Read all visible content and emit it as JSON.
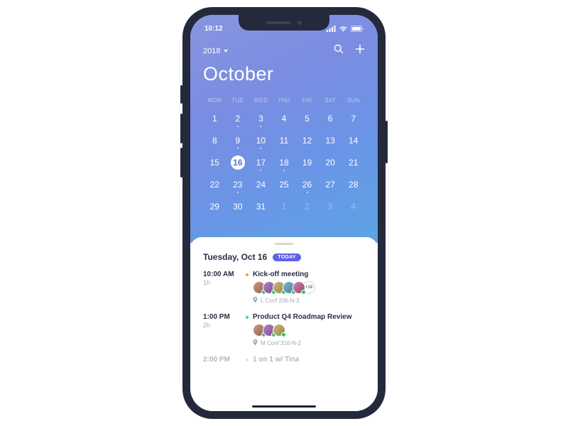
{
  "status": {
    "time": "10:12"
  },
  "header": {
    "year": "2018",
    "month": "October"
  },
  "dow": [
    "MON",
    "TUE",
    "WED",
    "THU",
    "FRI",
    "SAT",
    "SUN"
  ],
  "days": [
    {
      "n": "1"
    },
    {
      "n": "2",
      "dot": true
    },
    {
      "n": "3",
      "dot": true
    },
    {
      "n": "4"
    },
    {
      "n": "5"
    },
    {
      "n": "6"
    },
    {
      "n": "7"
    },
    {
      "n": "8"
    },
    {
      "n": "9",
      "dot": true
    },
    {
      "n": "10",
      "dot": true
    },
    {
      "n": "11"
    },
    {
      "n": "12"
    },
    {
      "n": "13"
    },
    {
      "n": "14"
    },
    {
      "n": "15"
    },
    {
      "n": "16",
      "sel": true
    },
    {
      "n": "17",
      "dot": true
    },
    {
      "n": "18",
      "dot": true
    },
    {
      "n": "19"
    },
    {
      "n": "20"
    },
    {
      "n": "21"
    },
    {
      "n": "22"
    },
    {
      "n": "23",
      "dot": true
    },
    {
      "n": "24"
    },
    {
      "n": "25"
    },
    {
      "n": "26",
      "dot": true
    },
    {
      "n": "27"
    },
    {
      "n": "28"
    },
    {
      "n": "29"
    },
    {
      "n": "30"
    },
    {
      "n": "31"
    },
    {
      "n": "1",
      "dim": true
    },
    {
      "n": "2",
      "dim": true
    },
    {
      "n": "3",
      "dim": true
    },
    {
      "n": "4",
      "dim": true
    }
  ],
  "sheet": {
    "date": "Tuesday, Oct 16",
    "badge": "TODAY"
  },
  "events": [
    {
      "time": "10:00 AM",
      "dur": "1h",
      "title": "Kick-off meeting",
      "color": "o",
      "av": 5,
      "more": "+18",
      "loc": "L Conf 206-N-3"
    },
    {
      "time": "1:00 PM",
      "dur": "2h",
      "title": "Product Q4 Roadmap Review",
      "color": "t",
      "av": 3,
      "loc": "M Conf 316-N-2"
    },
    {
      "time": "2:00 PM",
      "dur": "",
      "title": "1 on 1 w/ Tina",
      "color": "o",
      "fade": true
    }
  ],
  "avatarHues": [
    18,
    280,
    45,
    200,
    330
  ]
}
